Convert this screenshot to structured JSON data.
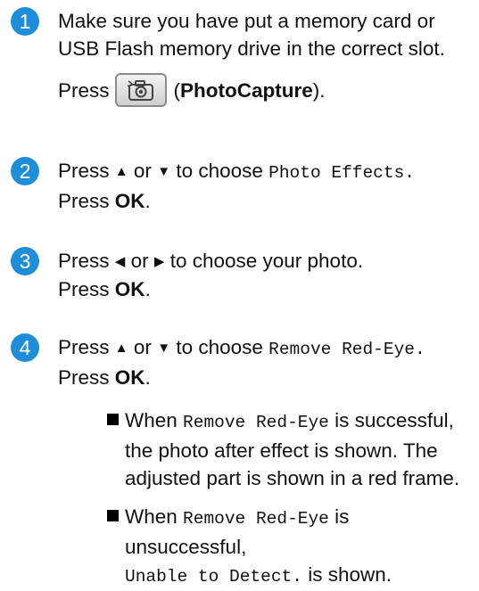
{
  "steps": [
    {
      "number": "1",
      "line1": "Make sure you have put a memory card or",
      "line2": "USB Flash memory drive in the correct slot.",
      "press": "Press",
      "button_name": "PhotoCapture"
    },
    {
      "number": "2",
      "pre": "Press",
      "up": "▲",
      "or": "or",
      "down": "▼",
      "to_choose": "to choose",
      "option": "Photo Effects.",
      "press": "Press",
      "ok": "OK",
      "period": "."
    },
    {
      "number": "3",
      "pre": "Press",
      "left": "◀",
      "or": "or",
      "right": "▶",
      "rest": "to choose your photo.",
      "press": "Press",
      "ok": "OK",
      "period": "."
    },
    {
      "number": "4",
      "pre": "Press",
      "up": "▲",
      "or": "or",
      "down": "▼",
      "to_choose": "to choose",
      "option": "Remove Red-Eye.",
      "press": "Press",
      "ok": "OK",
      "period": "."
    }
  ],
  "bullets": [
    {
      "when": "When",
      "option": "Remove Red-Eye",
      "rest1": "is successful,",
      "line2": "the photo after effect is shown. The",
      "line3": "adjusted part is shown in a red frame."
    },
    {
      "when": "When",
      "option": "Remove Red-Eye",
      "rest1": "is unsuccessful,",
      "mono2": "Unable to Detect.",
      "rest2": "is shown."
    }
  ],
  "colors": {
    "step_circle": "#1f8ed8"
  },
  "icons": {
    "photocapture_button": "camera-icon",
    "bullet": "square-bullet-icon"
  }
}
